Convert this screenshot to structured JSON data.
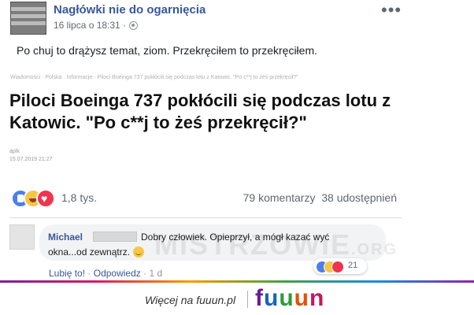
{
  "post": {
    "page_name": "Nagłówki nie do ogarnięcia",
    "timestamp": "16 lipca o 18:31 ·",
    "text": "Po chuj to drążysz temat, ziom. Przekręciłem to przekręciłem.",
    "menu_icon": "more-dots-icon",
    "privacy_icon": "globe-icon"
  },
  "article": {
    "breadcrumb": "Wiadomości · Polska · Informacje · Piloci Boeinga 737 pokłócili się podczas lotu z Katowic. \"Po c**j to żeś przekręcił?\"",
    "headline_line1": "Piloci Boeinga 737 pokłócili się podczas lotu z",
    "headline_line2": "Katowic. \"Po c**j to żeś przekręcił?\"",
    "source": "aplk",
    "source_date": "15.07.2019 21:27"
  },
  "reactions": {
    "count": "1,8 tys.",
    "comments": "79 komentarzy",
    "shares": "38 udostępnień",
    "icons": [
      "like-icon",
      "haha-icon",
      "love-icon"
    ]
  },
  "comment": {
    "author": "Michael",
    "text_line1": "Dobry człowiek. Opieprzył, a mógł kazać wyć",
    "text_line2": "okna...od zewnątrz.",
    "reaction_count": "21",
    "like_label": "Lubię to!",
    "reply_label": "Odpowiedz",
    "time": "1 d",
    "separator": "·"
  },
  "watermark": {
    "text": "MISTRZOWIE",
    "suffix": ".ORG"
  },
  "footer": {
    "text": "Więcej na fuuun.pl",
    "logo": [
      "f",
      "u",
      "u",
      "u",
      "n"
    ]
  },
  "colors": {
    "link_blue": "#385898",
    "like_blue": "#4c7fe8",
    "haha_yellow": "#f6c646",
    "love_red": "#f0344f"
  }
}
